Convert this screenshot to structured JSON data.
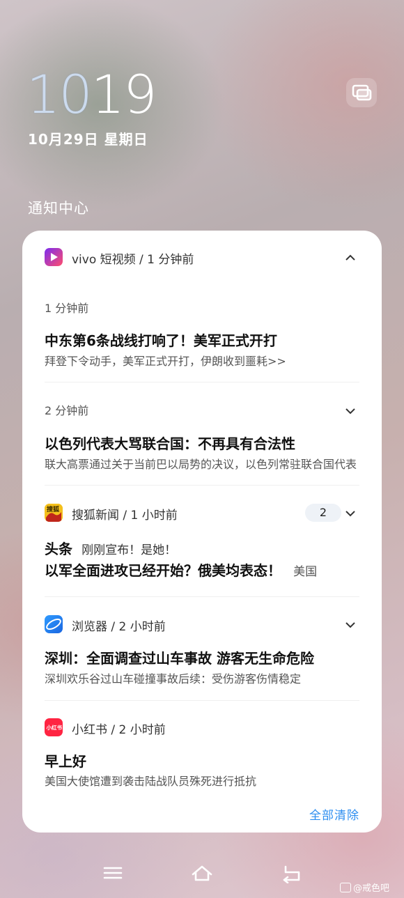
{
  "status": {
    "clock_hours": "10",
    "clock_minutes": "19",
    "date": "10月29日 星期日"
  },
  "notification_center": {
    "title": "通知中心",
    "clear_all": "全部清除"
  },
  "notifications": [
    {
      "app": "vivo 短视频 / 1 分钟前",
      "icon": "vivo-video-icon",
      "items": [
        {
          "time": "1 分钟前",
          "title": "中东第6条战线打响了！美军正式开打",
          "body": "拜登下令动手，美军正式开打，伊朗收到噩耗>>"
        },
        {
          "time": "2 分钟前",
          "title": "以色列代表大骂联合国：不再具有合法性",
          "body": "联大高票通过关于当前巴以局势的决议，以色列常驻联合国代表"
        }
      ]
    },
    {
      "app": "搜狐新闻 / 1 小时前",
      "icon": "sohu-news-icon",
      "badge": "2",
      "tag": "头条",
      "line1": "刚刚宣布！是她！",
      "title": "以军全面进攻已经开始？俄美均表态！",
      "title_tail": "美国"
    },
    {
      "app": "浏览器 / 2 小时前",
      "icon": "browser-icon",
      "title": "深圳：全面调查过山车事故 游客无生命危险",
      "body": "深圳欢乐谷过山车碰撞事故后续：受伤游客伤情稳定"
    },
    {
      "app": "小红书 / 2 小时前",
      "icon": "xiaohongshu-icon",
      "icon_text": "小红书",
      "title": "早上好",
      "body": "美国大使馆遭到袭击陆战队员殊死进行抵抗"
    }
  ],
  "watermark": "@戒色吧",
  "colors": {
    "accent": "#2f8ff0",
    "card_bg": "#ffffff"
  }
}
